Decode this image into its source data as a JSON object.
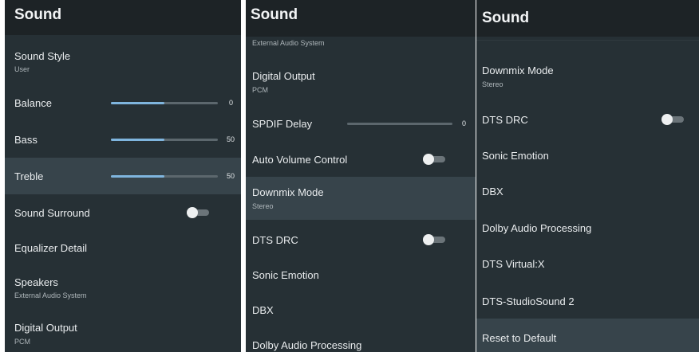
{
  "panel1": {
    "header": "Sound",
    "sound_style": {
      "title": "Sound Style",
      "value": "User"
    },
    "balance": {
      "title": "Balance",
      "value": "0",
      "fill": 0.5
    },
    "bass": {
      "title": "Bass",
      "value": "50",
      "fill": 0.5
    },
    "treble": {
      "title": "Treble",
      "value": "50",
      "fill": 0.5
    },
    "sound_surround": {
      "title": "Sound Surround",
      "on": false
    },
    "equalizer": {
      "title": "Equalizer Detail"
    },
    "speakers": {
      "title": "Speakers",
      "value": "External Audio System"
    },
    "digital_output": {
      "title": "Digital Output",
      "value": "PCM"
    }
  },
  "panel2": {
    "header": "Sound",
    "top_sub": "External Audio System",
    "digital_output": {
      "title": "Digital Output",
      "value": "PCM"
    },
    "spdif_delay": {
      "title": "SPDIF Delay",
      "value": "0",
      "fill": 0
    },
    "auto_volume": {
      "title": "Auto Volume Control",
      "on": false
    },
    "downmix": {
      "title": "Downmix Mode",
      "value": "Stereo"
    },
    "dts_drc": {
      "title": "DTS DRC",
      "on": false
    },
    "sonic_emotion": {
      "title": "Sonic Emotion"
    },
    "dbx": {
      "title": "DBX"
    },
    "dolby": {
      "title": "Dolby Audio Processing"
    }
  },
  "panel3": {
    "header": "Sound",
    "downmix": {
      "title": "Downmix Mode",
      "value": "Stereo"
    },
    "dts_drc": {
      "title": "DTS DRC",
      "on": false
    },
    "sonic_emotion": {
      "title": "Sonic Emotion"
    },
    "dbx": {
      "title": "DBX"
    },
    "dolby": {
      "title": "Dolby Audio Processing"
    },
    "dts_virtual": {
      "title": "DTS Virtual:X"
    },
    "dts_studio": {
      "title": "DTS-StudioSound 2"
    },
    "reset": {
      "title": "Reset to Default"
    }
  }
}
